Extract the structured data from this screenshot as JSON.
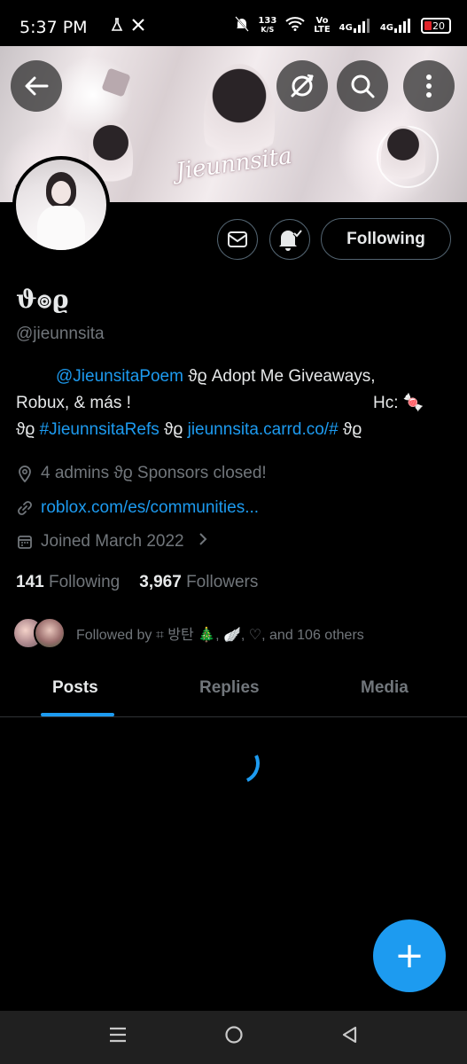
{
  "status_bar": {
    "time": "5:37 PM",
    "left_icons": [
      "flask-icon",
      "x-logo-icon"
    ],
    "net_speed_value": "133",
    "net_speed_unit": "K/S",
    "volte_top": "Vo",
    "volte_bottom": "LTE",
    "net1": "4G",
    "net2": "4G",
    "battery": "20"
  },
  "header": {
    "banner_title": "Jieunnsita",
    "back_icon": "arrow-left-icon",
    "sync_icon": "sync-off-icon",
    "search_icon": "search-icon",
    "more_icon": "more-vertical-icon"
  },
  "profile": {
    "display_name": "ϑ๏ϱ",
    "handle": "@jieunnsita",
    "bio": {
      "line1_link": "@JieunsitaPoem",
      "line1_text": " ϑϱ Adopt Me Giveaways,",
      "line2_left": "Robux, & más !",
      "line2_right": "Hc: 🍬",
      "line3_prefix": "ϑϱ ",
      "line3_hashtag": "#JieunnsitaRefs",
      "line3_mid": " ϑϱ ",
      "line3_link": "jieunnsita.carrd.co/#",
      "line3_suffix": " ϑϱ"
    },
    "location": "4 admins ϑϱ Sponsors closed!",
    "website": "roblox.com/es/communities...",
    "joined": "Joined March 2022",
    "following_count": "141",
    "following_label": "Following",
    "followers_count": "3,967",
    "followers_label": "Followers",
    "followed_by": "Followed by ⌗ 방탄 🎄, 🪽, ♡, and 106 others"
  },
  "actions": {
    "message_icon": "mail-icon",
    "notify_icon": "bell-check-icon",
    "following_button": "Following"
  },
  "tabs": [
    {
      "label": "Posts",
      "active": true
    },
    {
      "label": "Replies",
      "active": false
    },
    {
      "label": "Media",
      "active": false
    }
  ],
  "fab": {
    "label": "+"
  },
  "colors": {
    "accent": "#1d9bf0",
    "background": "#000000",
    "secondary_text": "#71767b",
    "primary_text": "#e7e9ea"
  }
}
